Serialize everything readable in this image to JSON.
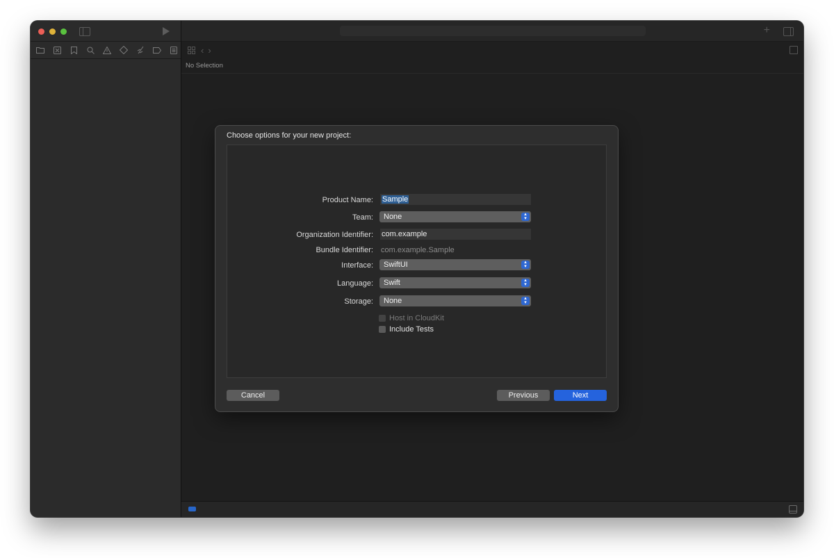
{
  "window": {
    "traffic_lights": {
      "close": "#ec5f57",
      "minimize": "#e0b33a",
      "zoom": "#5ac23f"
    }
  },
  "navigator_icons": [
    "folder-icon",
    "source-control-icon",
    "bookmark-icon",
    "search-icon",
    "warning-icon",
    "test-icon",
    "debug-icon",
    "breakpoint-icon",
    "report-icon"
  ],
  "editor": {
    "no_selection": "No Selection"
  },
  "sheet": {
    "title": "Choose options for your new project:",
    "fields": {
      "product_name": {
        "label": "Product Name:",
        "value": "Sample"
      },
      "team": {
        "label": "Team:",
        "value": "None"
      },
      "org_identifier": {
        "label": "Organization Identifier:",
        "value": "com.example"
      },
      "bundle_identifier": {
        "label": "Bundle Identifier:",
        "value": "com.example.Sample"
      },
      "interface": {
        "label": "Interface:",
        "value": "SwiftUI"
      },
      "language": {
        "label": "Language:",
        "value": "Swift"
      },
      "storage": {
        "label": "Storage:",
        "value": "None"
      }
    },
    "checkboxes": {
      "host_in_cloudkit": {
        "label": "Host in CloudKit",
        "checked": false,
        "enabled": false
      },
      "include_tests": {
        "label": "Include Tests",
        "checked": false,
        "enabled": true
      }
    },
    "buttons": {
      "cancel": "Cancel",
      "previous": "Previous",
      "next": "Next"
    },
    "accent_color": "#2563dd"
  }
}
